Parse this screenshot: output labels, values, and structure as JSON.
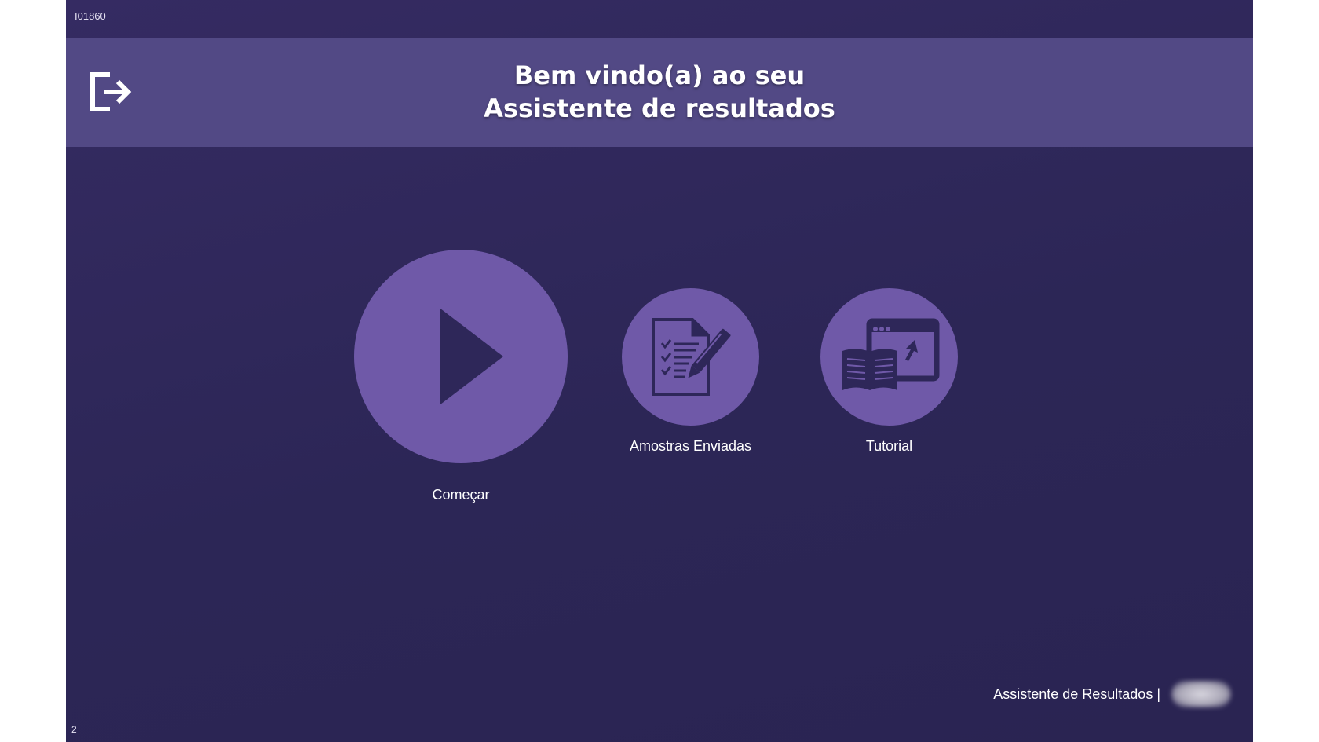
{
  "device_id": "I01860",
  "header": {
    "title_line1": "Bem vindo(a) ao seu",
    "title_line2": "Assistente de resultados",
    "logout_icon": "logout-icon"
  },
  "menu": {
    "start": {
      "label": "Começar",
      "icon": "play-icon"
    },
    "sent_samples": {
      "label": "Amostras Enviadas",
      "icon": "document-checklist-icon"
    },
    "tutorial": {
      "label": "Tutorial",
      "icon": "tutorial-book-icon"
    }
  },
  "footer": {
    "label": "Assistente de Resultados |",
    "logo": "brand-logo"
  },
  "page_number": "2",
  "colors": {
    "background": "#2e2759",
    "header_band": "#524985",
    "circle": "#6f59a8",
    "icon": "#2e2759",
    "text": "#ffffff"
  }
}
